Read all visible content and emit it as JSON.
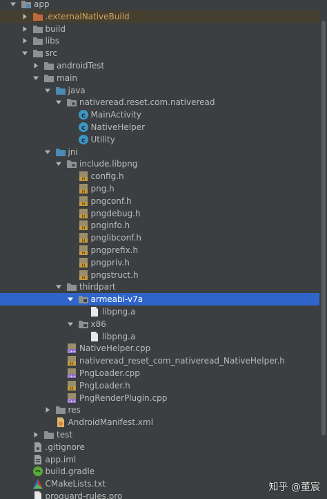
{
  "tree": {
    "rows": [
      {
        "indent": 0,
        "arrow": "open",
        "icon": "module-folder",
        "label": "app"
      },
      {
        "indent": 1,
        "arrow": "closed",
        "icon": "folder-orange",
        "label": ".externalNativeBuild",
        "label_color": "orange",
        "highlighted": true
      },
      {
        "indent": 1,
        "arrow": "closed",
        "icon": "folder",
        "label": "build"
      },
      {
        "indent": 1,
        "arrow": "closed",
        "icon": "folder",
        "label": "libs"
      },
      {
        "indent": 1,
        "arrow": "open",
        "icon": "folder",
        "label": "src"
      },
      {
        "indent": 2,
        "arrow": "closed",
        "icon": "folder",
        "label": "androidTest"
      },
      {
        "indent": 2,
        "arrow": "open",
        "icon": "folder",
        "label": "main"
      },
      {
        "indent": 3,
        "arrow": "open",
        "icon": "folder-blue",
        "label": "java"
      },
      {
        "indent": 4,
        "arrow": "open",
        "icon": "package",
        "label": "nativeread.reset.com.nativeread"
      },
      {
        "indent": 5,
        "arrow": "none",
        "icon": "class",
        "label": "MainActivity"
      },
      {
        "indent": 5,
        "arrow": "none",
        "icon": "class",
        "label": "NativeHelper"
      },
      {
        "indent": 5,
        "arrow": "none",
        "icon": "class",
        "label": "Utility"
      },
      {
        "indent": 3,
        "arrow": "open",
        "icon": "folder-blue",
        "label": "jni"
      },
      {
        "indent": 4,
        "arrow": "open",
        "icon": "package",
        "label": "include.libpng"
      },
      {
        "indent": 5,
        "arrow": "none",
        "icon": "header-file",
        "label": "config.h"
      },
      {
        "indent": 5,
        "arrow": "none",
        "icon": "header-file",
        "label": "png.h"
      },
      {
        "indent": 5,
        "arrow": "none",
        "icon": "header-file",
        "label": "pngconf.h"
      },
      {
        "indent": 5,
        "arrow": "none",
        "icon": "header-file",
        "label": "pngdebug.h"
      },
      {
        "indent": 5,
        "arrow": "none",
        "icon": "header-file",
        "label": "pnginfo.h"
      },
      {
        "indent": 5,
        "arrow": "none",
        "icon": "header-file",
        "label": "pnglibconf.h"
      },
      {
        "indent": 5,
        "arrow": "none",
        "icon": "header-file",
        "label": "pngprefix.h"
      },
      {
        "indent": 5,
        "arrow": "none",
        "icon": "header-file",
        "label": "pngpriv.h"
      },
      {
        "indent": 5,
        "arrow": "none",
        "icon": "header-file",
        "label": "pngstruct.h"
      },
      {
        "indent": 4,
        "arrow": "open",
        "icon": "folder",
        "label": "thirdpart"
      },
      {
        "indent": 5,
        "arrow": "open",
        "icon": "folder-package",
        "label": "armeabi-v7a",
        "selected": true
      },
      {
        "indent": 6,
        "arrow": "none",
        "icon": "file",
        "label": "libpng.a"
      },
      {
        "indent": 5,
        "arrow": "open",
        "icon": "folder-package",
        "label": "x86"
      },
      {
        "indent": 6,
        "arrow": "none",
        "icon": "file",
        "label": "libpng.a"
      },
      {
        "indent": 4,
        "arrow": "none",
        "icon": "cpp-file",
        "label": "NativeHelper.cpp"
      },
      {
        "indent": 4,
        "arrow": "none",
        "icon": "header-file",
        "label": "nativeread_reset_com_nativeread_NativeHelper.h"
      },
      {
        "indent": 4,
        "arrow": "none",
        "icon": "cpp-file",
        "label": "PngLoader.cpp"
      },
      {
        "indent": 4,
        "arrow": "none",
        "icon": "header-file",
        "label": "PngLoader.h"
      },
      {
        "indent": 4,
        "arrow": "none",
        "icon": "cpp-file",
        "label": "PngRenderPlugin.cpp"
      },
      {
        "indent": 3,
        "arrow": "closed",
        "icon": "folder",
        "label": "res"
      },
      {
        "indent": 3,
        "arrow": "none",
        "icon": "manifest-file",
        "label": "AndroidManifest.xml"
      },
      {
        "indent": 2,
        "arrow": "closed",
        "icon": "folder",
        "label": "test"
      },
      {
        "indent": 1,
        "arrow": "none",
        "icon": "gitignore-file",
        "label": ".gitignore"
      },
      {
        "indent": 1,
        "arrow": "none",
        "icon": "iml-file",
        "label": "app.iml"
      },
      {
        "indent": 1,
        "arrow": "none",
        "icon": "gradle-file",
        "label": "build.gradle"
      },
      {
        "indent": 1,
        "arrow": "none",
        "icon": "cmake-file",
        "label": "CMakeLists.txt"
      },
      {
        "indent": 1,
        "arrow": "none",
        "icon": "file",
        "label": "proguard-rules.pro"
      }
    ]
  },
  "watermark": "知乎 @董宸",
  "colors": {
    "background": "#3c3f41",
    "selection": "#2f65ca",
    "highlight_row": "#453f2f",
    "text": "#bbbbbb",
    "excluded_text": "#d9a35b"
  }
}
